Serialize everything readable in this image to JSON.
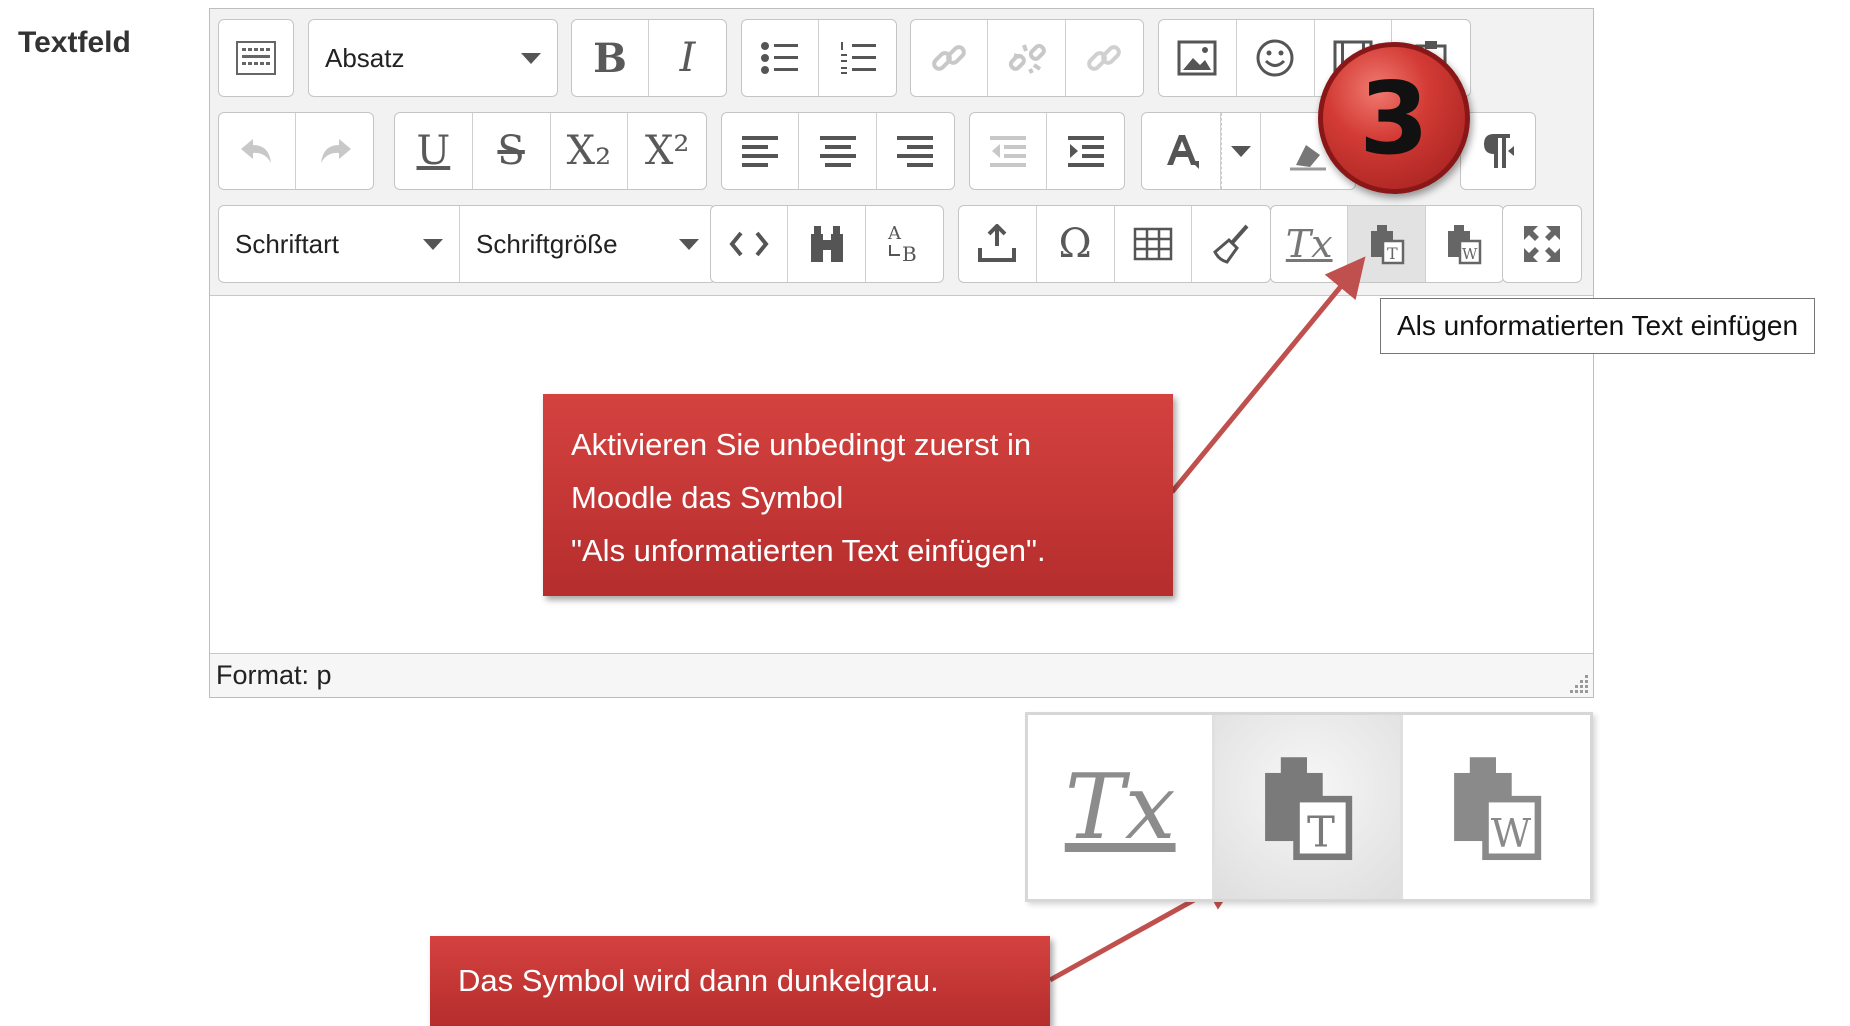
{
  "field_label": "Textfeld",
  "toolbar": {
    "row1": {
      "format_select": "Absatz",
      "bold": "B",
      "italic": "I"
    },
    "row2": {
      "underline": "U",
      "strike": "S",
      "subscript": "X₂",
      "superscript": "X²"
    },
    "row3": {
      "font_select": "Schriftart",
      "size_select": "Schriftgröße",
      "omega": "Ω",
      "clear_format": "Tx"
    }
  },
  "statusbar": {
    "label": "Format: p"
  },
  "tooltip": "Als unformatierten Text einfügen",
  "step_number": "3",
  "callouts": {
    "main_lines": [
      "Aktivieren Sie unbedingt zuerst in",
      "Moodle das Symbol",
      "\"Als unformatierten Text einfügen\"."
    ],
    "secondary": "Das Symbol wird dann dunkelgrau."
  },
  "zoom": {
    "clear_format": "Tx"
  },
  "colors": {
    "callout": "#c43a37",
    "arrow": "#c0504d",
    "toolbar_bg": "#f2f2f2"
  }
}
